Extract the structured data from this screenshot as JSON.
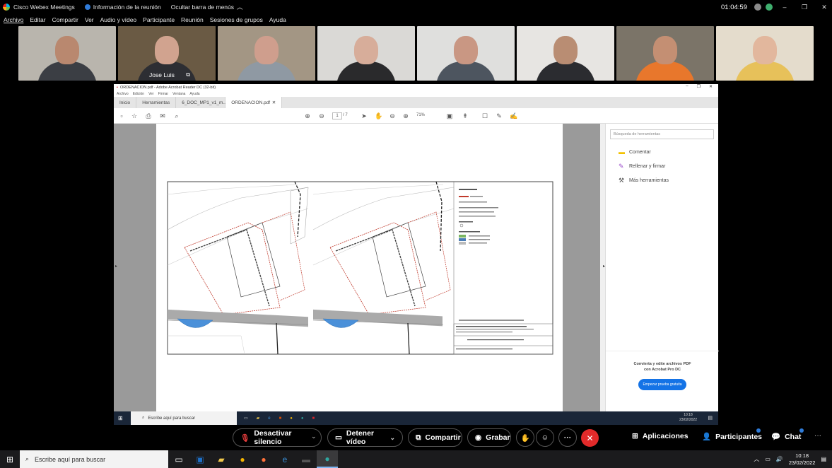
{
  "titlebar": {
    "app_name": "Cisco Webex Meetings",
    "meeting_info": "Información de la reunión",
    "hide_menu": "Ocultar barra de menús",
    "elapsed": "01:04:59",
    "min": "–",
    "max": "❐",
    "close": "✕"
  },
  "menu": [
    "Archivo",
    "Editar",
    "Compartir",
    "Ver",
    "Audio y vídeo",
    "Participante",
    "Reunión",
    "Sesiones de grupos",
    "Ayuda"
  ],
  "participants": [
    {
      "name": "",
      "bg": "#b9b5ad",
      "shirt": "#3b3e44",
      "skin": "#b9886f"
    },
    {
      "name": "Jose Luis",
      "bg": "#6a5a44",
      "shirt": "#2d2e33",
      "skin": "#d1a38f"
    },
    {
      "name": "",
      "bg": "#a39684",
      "shirt": "#8f99a3",
      "skin": "#cf9e8d"
    },
    {
      "name": "",
      "bg": "#dad9d6",
      "shirt": "#2a2a2c",
      "skin": "#d7ad9a"
    },
    {
      "name": "",
      "bg": "#dfdfdd",
      "shirt": "#4d555f",
      "skin": "#c99783"
    },
    {
      "name": "",
      "bg": "#e7e5e2",
      "shirt": "#2b2c30",
      "skin": "#b98d73"
    },
    {
      "name": "",
      "bg": "#7b7468",
      "shirt": "#e8772c",
      "skin": "#c48f73"
    },
    {
      "name": "",
      "bg": "#e4dccc",
      "shirt": "#e7c15a",
      "skin": "#e2b79d"
    }
  ],
  "acrobat": {
    "title": "ORDENACION.pdf - Adobe Acrobat Reader DC (32-bit)",
    "menu": [
      "Archivo",
      "Edición",
      "Ver",
      "Firmar",
      "Ventana",
      "Ayuda"
    ],
    "tabs": [
      "Inicio",
      "Herramientas",
      "6_DOC_MP1_v1_m...",
      "ORDENACION.pdf"
    ],
    "page_current": "1",
    "page_total": "/ 7",
    "zoom": "71%",
    "tools_search": "Búsqueda de herramientas",
    "tools": [
      "Comentar",
      "Rellenar y firmar",
      "Más herramientas"
    ],
    "promo_line1": "Convierta y edite archivos PDF",
    "promo_line2": "con Acrobat Pro DC",
    "promo_button": "Empezar prueba gratuita",
    "inner_search": "Escribe aquí para buscar",
    "inner_time": "10:18",
    "inner_date": "23/02/2022"
  },
  "controls": {
    "mute": "Desactivar silencio",
    "video": "Detener vídeo",
    "share": "Compartir",
    "record": "Grabar",
    "apps": "Aplicaciones",
    "participants": "Participantes",
    "chat": "Chat",
    "more": "···"
  },
  "taskbar": {
    "search_placeholder": "Escribe aquí para buscar",
    "time": "10:18",
    "date": "23/02/2022"
  }
}
